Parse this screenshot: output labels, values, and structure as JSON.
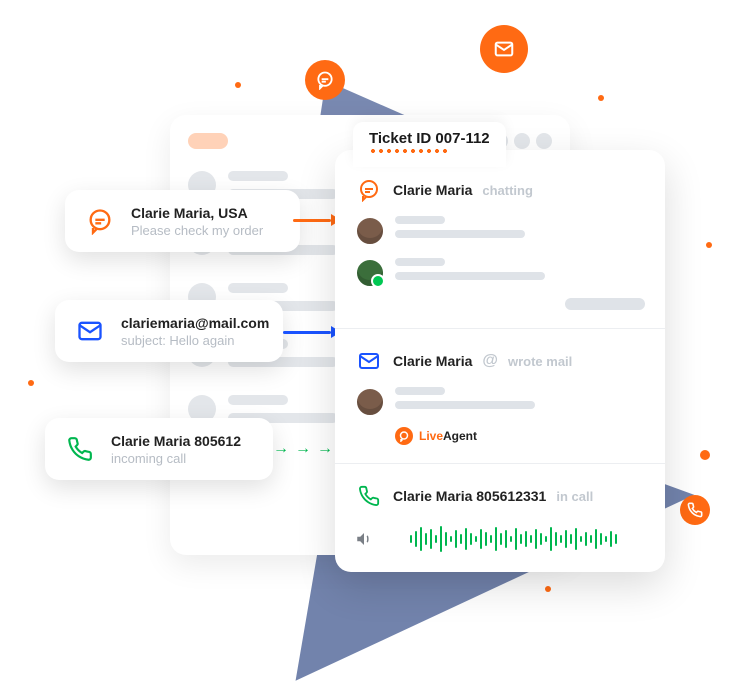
{
  "ticket": {
    "title": "Ticket ID 007-112",
    "chat": {
      "name": "Clarie Maria",
      "status": "chatting"
    },
    "mail": {
      "name": "Clarie Maria",
      "status": "wrote mail",
      "brand_prefix": "Live",
      "brand_suffix": "Agent"
    },
    "call": {
      "name": "Clarie Maria 805612331",
      "status": "in call"
    }
  },
  "cards": {
    "chat": {
      "title": "Clarie Maria, USA",
      "subtitle": "Please check my order"
    },
    "mail": {
      "title": "clariemaria@mail.com",
      "subtitle": "subject: Hello again"
    },
    "call": {
      "title": "Clarie Maria 805612",
      "subtitle": "incoming call"
    }
  }
}
